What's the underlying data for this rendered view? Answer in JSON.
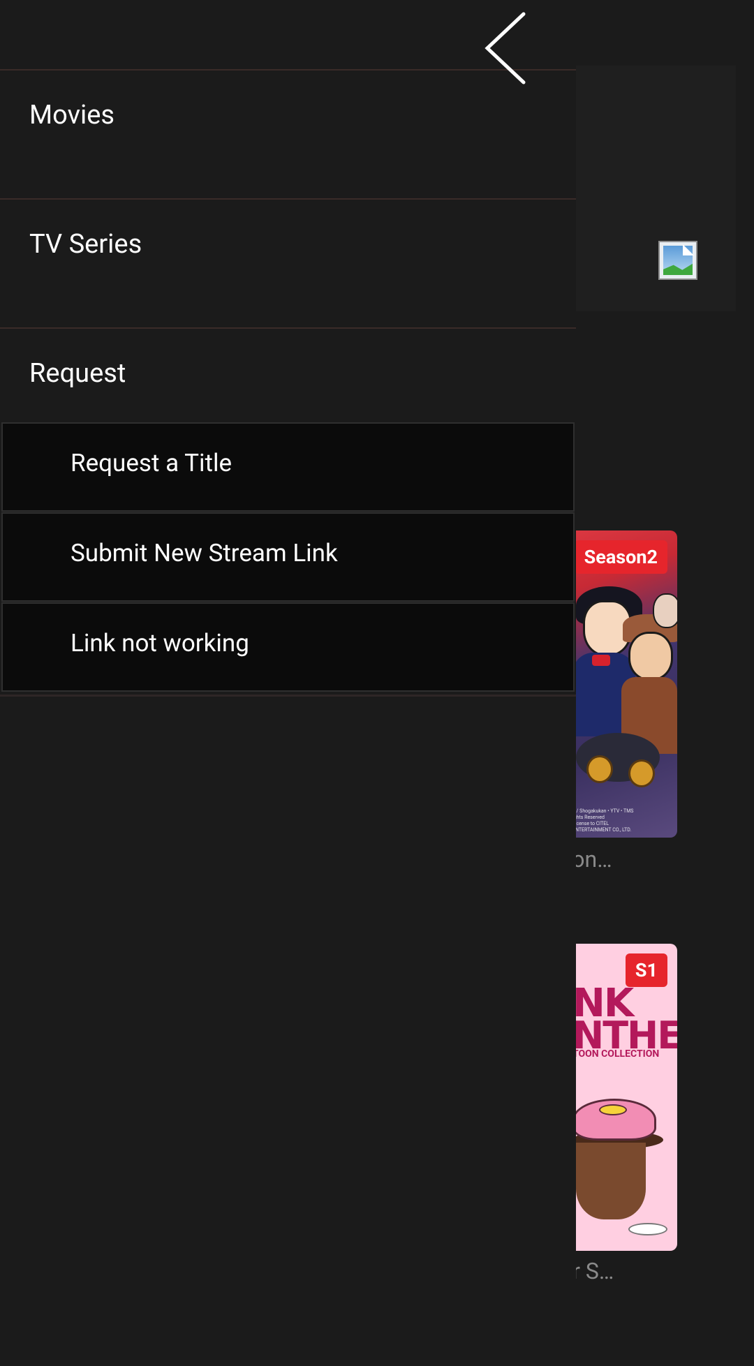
{
  "drawer": {
    "back_icon": "chevron-left-icon",
    "items": [
      {
        "label": "Movies"
      },
      {
        "label": "TV Series"
      },
      {
        "label": "Request"
      }
    ],
    "request_subitems": [
      {
        "label": "Request a Title"
      },
      {
        "label": "Submit New Stream Link"
      },
      {
        "label": "Link not working"
      }
    ]
  },
  "background": {
    "banner_icon": "broken-image-icon",
    "posters": [
      {
        "badge": "Season2",
        "caption": "tive Con…",
        "copyright": "a / Shogakukan • YTV • TMS\nights Reserved\nLicense to CITEL\nENTERTAINMENT CO., LTD."
      },
      {
        "badge": "S1",
        "caption": "anther S…",
        "art_title_1": "NK",
        "art_title_2": "NTHER",
        "art_subtitle": "TOON COLLECTION"
      }
    ]
  },
  "colors": {
    "background": "#1b1b1b",
    "submenu_background": "#0b0b0b",
    "divider": "#3a2b28",
    "badge": "#e6252c",
    "caption": "#8a8a8a"
  }
}
